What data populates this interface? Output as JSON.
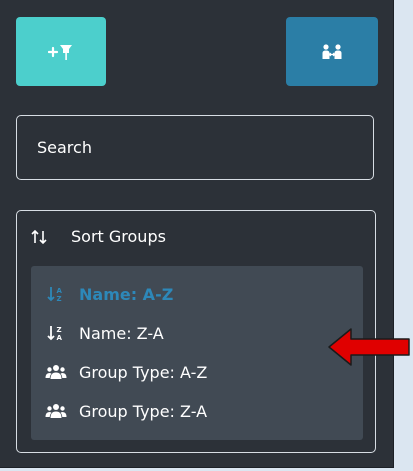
{
  "toolbar": {
    "add_button_icon": "pin-plus-icon",
    "users_button_icon": "users-link-icon",
    "add_button_color": "#4ccfcc",
    "users_button_color": "#2b7ea6"
  },
  "search": {
    "placeholder": "Search"
  },
  "sort": {
    "header_label": "Sort Groups",
    "header_icon": "sort-arrows-icon",
    "options": [
      {
        "label": "Name: A-Z",
        "icon": "sort-alpha-asc-icon",
        "active": true
      },
      {
        "label": "Name: Z-A",
        "icon": "sort-alpha-desc-icon",
        "active": false
      },
      {
        "label": "Group Type: A-Z",
        "icon": "users-icon",
        "active": false
      },
      {
        "label": "Group Type: Z-A",
        "icon": "users-icon",
        "active": false
      }
    ],
    "active_color": "#2d88b9"
  },
  "annotation": {
    "arrow_icon": "red-arrow-left-icon",
    "color": "#e00000"
  }
}
